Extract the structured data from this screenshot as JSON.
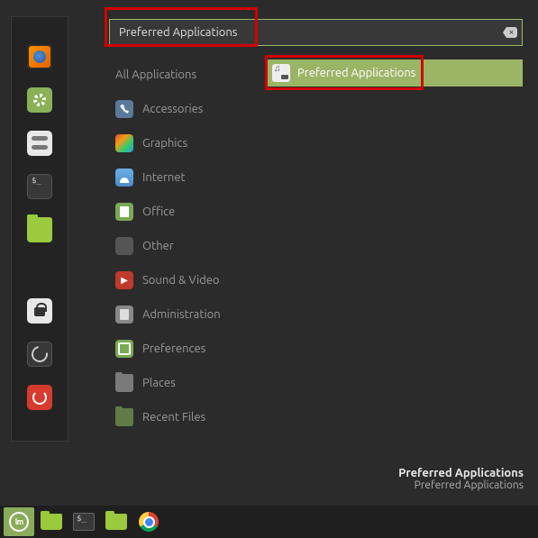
{
  "search": {
    "value": "Preferred Applications",
    "placeholder": ""
  },
  "categories": {
    "all": "All Applications",
    "items": [
      {
        "label": "Accessories"
      },
      {
        "label": "Graphics"
      },
      {
        "label": "Internet"
      },
      {
        "label": "Office"
      },
      {
        "label": "Other"
      },
      {
        "label": "Sound & Video"
      },
      {
        "label": "Administration"
      },
      {
        "label": "Preferences"
      },
      {
        "label": "Places"
      },
      {
        "label": "Recent Files"
      }
    ]
  },
  "results": {
    "items": [
      {
        "label": "Preferred Applications"
      }
    ]
  },
  "tooltip": {
    "title": "Preferred Applications",
    "subtitle": "Preferred Applications"
  }
}
